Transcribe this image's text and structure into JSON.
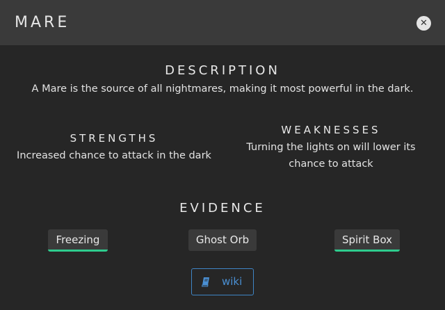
{
  "header": {
    "title": "MARE",
    "close_glyph": "✕",
    "close_icon": "close-icon"
  },
  "description": {
    "heading": "DESCRIPTION",
    "text": "A Mare is the source of all nightmares, making it most powerful in the dark."
  },
  "strengths": {
    "heading": "STRENGTHS",
    "text": "Increased chance to attack in the dark"
  },
  "weaknesses": {
    "heading": "WEAKNESSES",
    "text": "Turning the lights on will lower its chance to attack"
  },
  "evidence": {
    "heading": "EVIDENCE",
    "items": [
      {
        "label": "Freezing",
        "found": true
      },
      {
        "label": "Ghost Orb",
        "found": false
      },
      {
        "label": "Spirit Box",
        "found": true
      }
    ],
    "found_color": "#2ecc8e"
  },
  "wiki": {
    "label": "wiki",
    "icon": "book-icon",
    "color": "#4a90d4"
  }
}
